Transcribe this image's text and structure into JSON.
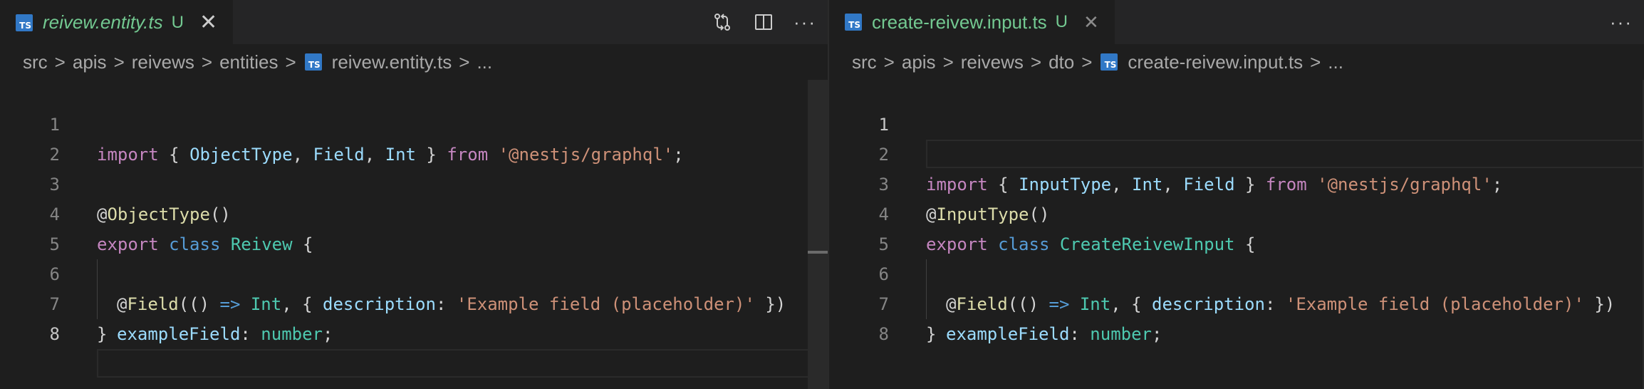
{
  "left": {
    "tab": {
      "title": "reivew.entity.ts",
      "status": "U",
      "close": "✕"
    },
    "actions": {
      "more": "···"
    },
    "breadcrumb": [
      "src",
      "apis",
      "reivews",
      "entities",
      "reivew.entity.ts",
      "..."
    ],
    "line_numbers": [
      "1",
      "2",
      "3",
      "4",
      "5",
      "6",
      "7",
      "8"
    ],
    "code": {
      "l1": {
        "a": "import",
        "b": " { ",
        "c": "ObjectType",
        "d": ", ",
        "e": "Field",
        "f": ", ",
        "g": "Int",
        "h": " } ",
        "i": "from",
        "j": " ",
        "k": "'@nestjs/graphql'",
        "l": ";"
      },
      "l3": {
        "a": "@",
        "b": "ObjectType",
        "c": "()"
      },
      "l4": {
        "a": "export",
        "b": " ",
        "c": "class",
        "d": " ",
        "e": "Reivew",
        "f": " {"
      },
      "l5": {
        "a": "@",
        "b": "Field",
        "c": "(() ",
        "d": "=>",
        "e": " ",
        "f": "Int",
        "g": ", { ",
        "h": "description",
        "i": ": ",
        "j": "'Example field (placeholder)'",
        "k": " })"
      },
      "l6": {
        "a": "exampleField",
        "b": ": ",
        "c": "number",
        "d": ";"
      },
      "l7": {
        "a": "}"
      }
    }
  },
  "right": {
    "tab": {
      "title": "create-reivew.input.ts",
      "status": "U",
      "close": "✕"
    },
    "actions": {
      "more": "···"
    },
    "breadcrumb": [
      "src",
      "apis",
      "reivews",
      "dto",
      "create-reivew.input.ts",
      "..."
    ],
    "line_numbers": [
      "1",
      "2",
      "3",
      "4",
      "5",
      "6",
      "7",
      "8"
    ],
    "code": {
      "l1": {
        "a": "import",
        "b": " { ",
        "c": "InputType",
        "d": ", ",
        "e": "Int",
        "f": ", ",
        "g": "Field",
        "h": " } ",
        "i": "from",
        "j": " ",
        "k": "'@nestjs/graphql'",
        "l": ";"
      },
      "l3": {
        "a": "@",
        "b": "InputType",
        "c": "()"
      },
      "l4": {
        "a": "export",
        "b": " ",
        "c": "class",
        "d": " ",
        "e": "CreateReivewInput",
        "f": " {"
      },
      "l5": {
        "a": "@",
        "b": "Field",
        "c": "(() ",
        "d": "=>",
        "e": " ",
        "f": "Int",
        "g": ", { ",
        "h": "description",
        "i": ": ",
        "j": "'Example field (placeholder)'",
        "k": " })"
      },
      "l6": {
        "a": "exampleField",
        "b": ": ",
        "c": "number",
        "d": ";"
      },
      "l7": {
        "a": "}"
      }
    }
  },
  "icons": {
    "ts_badge": "TS",
    "breadcrumb_separator": ">"
  },
  "colors": {
    "background": "#1e1e1e",
    "tab_bar": "#252526",
    "untracked": "#73c991",
    "ts_badge": "#3178c6"
  }
}
